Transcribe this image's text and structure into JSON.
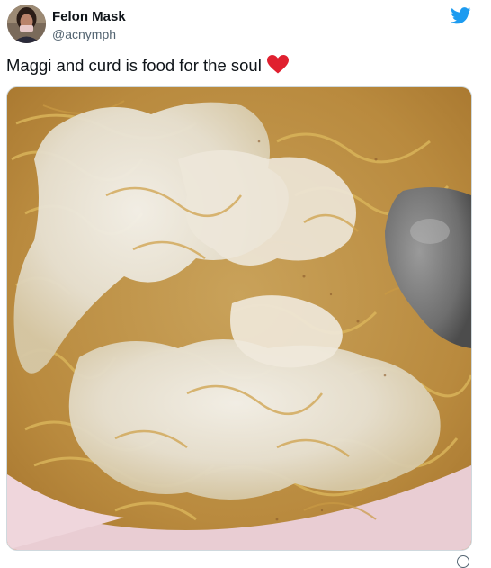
{
  "author": {
    "display_name": "Felon Mask",
    "handle": "@acnymph"
  },
  "tweet": {
    "text": "Maggi and curd is food for the soul",
    "emoji": "red-heart-icon"
  },
  "icons": {
    "platform": "twitter-bird-icon",
    "heart_color": "#e0202f",
    "bird_color": "#1d9bf0"
  }
}
